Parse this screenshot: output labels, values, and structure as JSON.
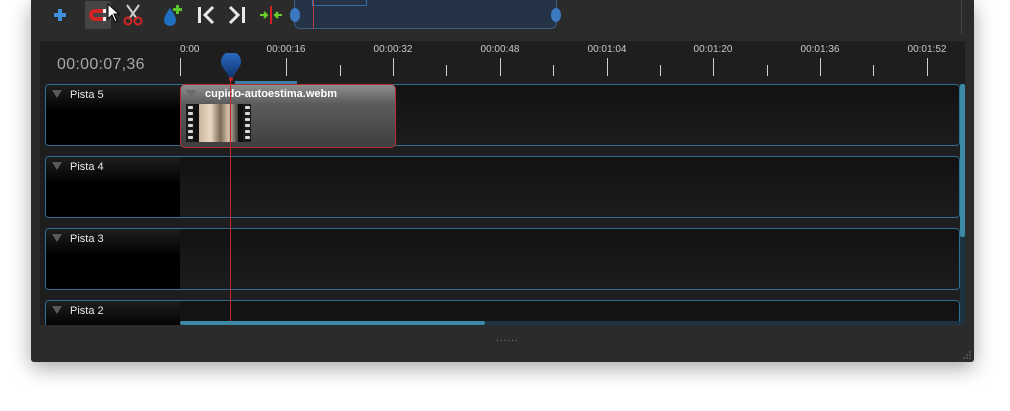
{
  "toolbar": {
    "buttons": [
      {
        "name": "add-track",
        "icon": "plus-icon"
      },
      {
        "name": "snapping-toggle",
        "icon": "magnet-icon",
        "active": true
      },
      {
        "name": "razor-tool",
        "icon": "scissors-icon"
      },
      {
        "name": "add-marker",
        "icon": "marker-add-icon"
      },
      {
        "name": "previous-marker",
        "icon": "jump-start-icon"
      },
      {
        "name": "next-marker",
        "icon": "jump-end-icon"
      },
      {
        "name": "center-playhead",
        "icon": "center-arrows-icon"
      }
    ]
  },
  "timeline": {
    "current_time": "00:00:07,36",
    "ruler_labels": [
      "0:00",
      "00:00:16",
      "00:00:32",
      "00:00:48",
      "00:01:04",
      "00:01:20",
      "00:01:36",
      "00:01:52"
    ],
    "tracks": [
      {
        "name": "Pista 5"
      },
      {
        "name": "Pista 4"
      },
      {
        "name": "Pista 3"
      },
      {
        "name": "Pista 2"
      }
    ],
    "clips": [
      {
        "title": "cupido-autoestima.webm",
        "track": "Pista 5"
      }
    ]
  },
  "splitter_grip": "......",
  "colors": {
    "accent": "#3c89a7",
    "playhead": "#c0282a",
    "clip_border": "#b33030",
    "track_border": "#2f6e95"
  }
}
